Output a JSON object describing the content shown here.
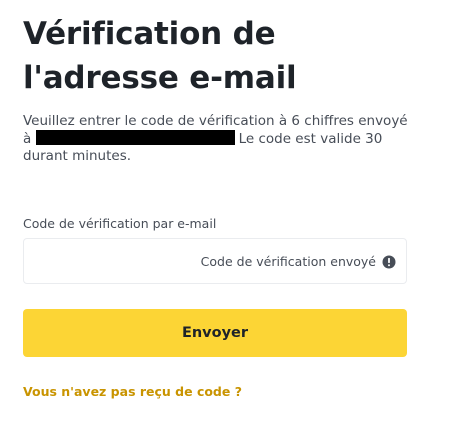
{
  "page": {
    "title": "Vérification de l'adresse e-mail",
    "description": {
      "before": "Veuillez entrer le code de vérification à 6 chiffres envoyé à",
      "after": "Le code est valide 30 durant minutes."
    }
  },
  "form": {
    "label": "Code de vérification par e-mail",
    "value": "",
    "suffix_text": "Code de vérification envoyé",
    "suffix_icon": "info-circle-icon",
    "submit_label": "Envoyer"
  },
  "footer": {
    "resend_link": "Vous n'avez pas reçu de code ?"
  },
  "colors": {
    "accent": "#fcd535",
    "link": "#c99400",
    "text": "#1e2329",
    "muted": "#474d57"
  }
}
